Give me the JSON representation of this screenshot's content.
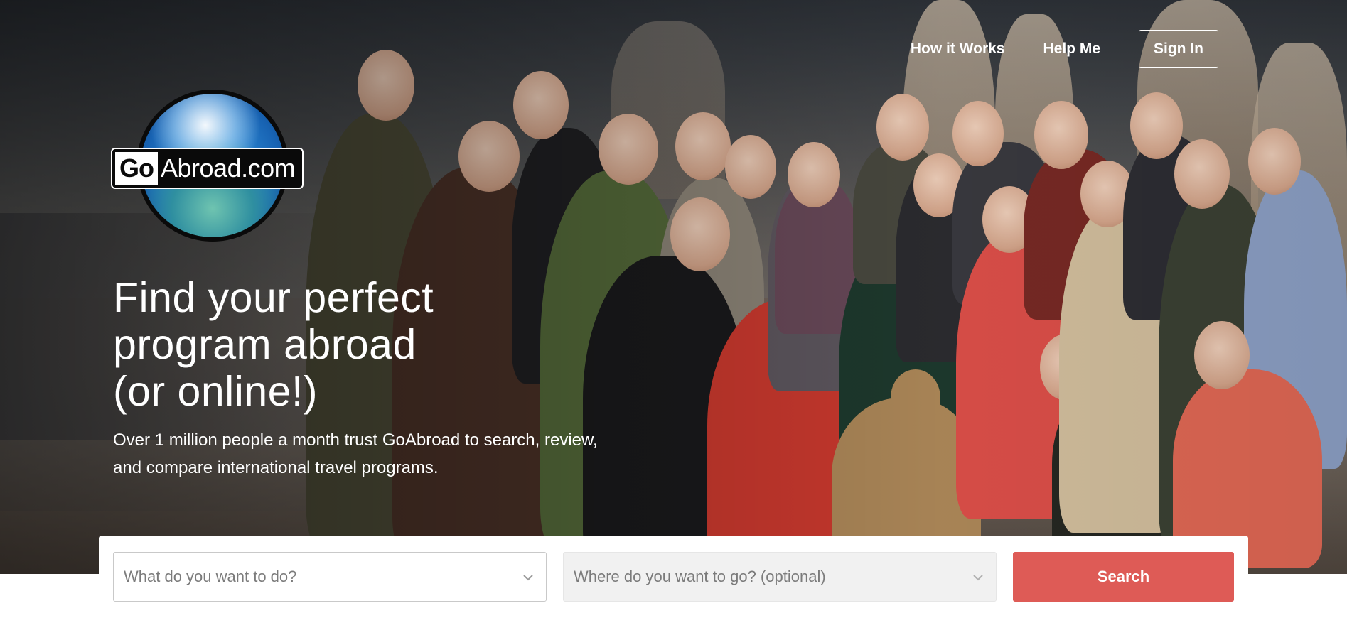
{
  "site": {
    "logo_text_go": "Go",
    "logo_text_rest": "Abroad.com"
  },
  "nav": {
    "how_it_works": "How it Works",
    "help_me": "Help Me",
    "sign_in": "Sign In"
  },
  "hero": {
    "headline_line1": "Find your perfect",
    "headline_line2": "program abroad",
    "headline_line3": "(or online!)",
    "subhead_line1": "Over 1 million people a month trust GoAbroad to search, review,",
    "subhead_line2": "and compare international travel programs."
  },
  "search": {
    "what_placeholder": "What do you want to do?",
    "where_placeholder": "Where do you want to go? (optional)",
    "button_label": "Search"
  },
  "colors": {
    "accent": "#de5b56",
    "text_on_hero": "#ffffff",
    "placeholder": "#7b7b7b",
    "disabled_field": "#f1f1f1"
  },
  "icons": {
    "dropdown": "chevron-down-icon",
    "logo": "globe-icon"
  }
}
